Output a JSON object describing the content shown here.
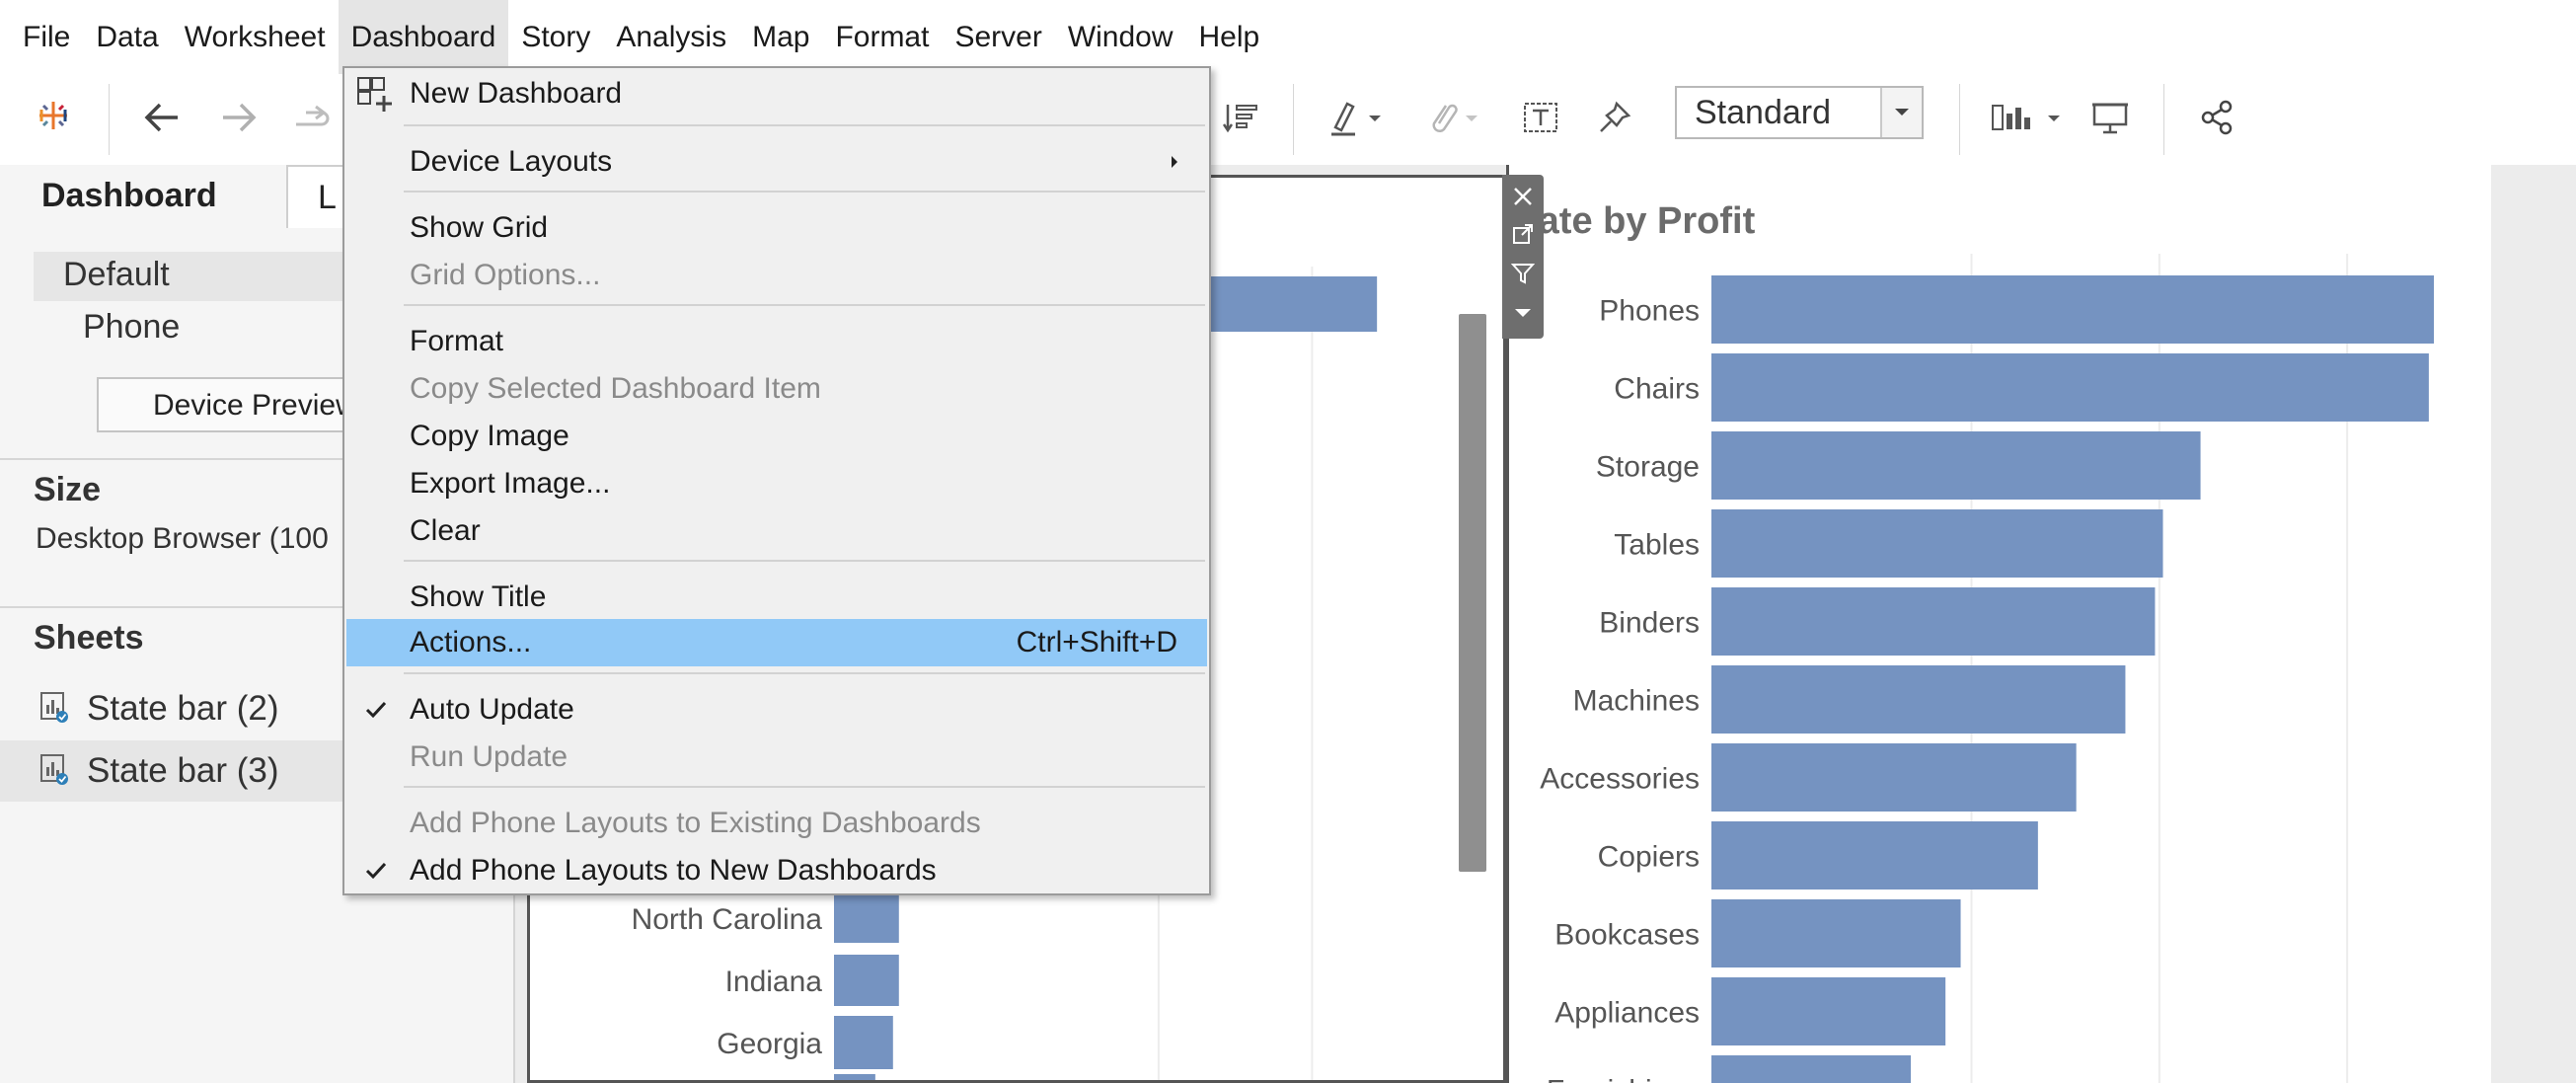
{
  "menubar": {
    "items": [
      "File",
      "Data",
      "Worksheet",
      "Dashboard",
      "Story",
      "Analysis",
      "Map",
      "Format",
      "Server",
      "Window",
      "Help"
    ],
    "active": "Dashboard"
  },
  "toolbar": {
    "fit_select_value": "Standard",
    "icons": [
      "tableau-logo-icon",
      "back-arrow-icon",
      "forward-arrow-icon",
      "redo-icon",
      "sort-icon",
      "highlight-icon",
      "attachment-icon",
      "text-box-icon",
      "pin-icon",
      "show-me-icon",
      "presentation-icon",
      "share-icon"
    ]
  },
  "left_panel": {
    "tabs": {
      "dashboard": "Dashboard",
      "layout": "L"
    },
    "device_default": "Default",
    "device_phone": "Phone",
    "device_preview_button": "Device Preview",
    "size_heading": "Size",
    "size_value": "Desktop Browser (100",
    "sheets_heading": "Sheets",
    "sheets": [
      "State bar (2)",
      "State bar (3)"
    ]
  },
  "dropdown": {
    "items": [
      {
        "label": "New Dashboard",
        "enabled": true,
        "icon": "new-dashboard-icon"
      },
      {
        "label": "Device Layouts",
        "enabled": true,
        "submenu": true
      },
      {
        "label": "Show Grid",
        "enabled": true
      },
      {
        "label": "Grid Options...",
        "enabled": false
      },
      {
        "label": "Format",
        "enabled": true
      },
      {
        "label": "Copy Selected Dashboard Item",
        "enabled": false
      },
      {
        "label": "Copy Image",
        "enabled": true
      },
      {
        "label": "Export Image...",
        "enabled": true
      },
      {
        "label": "Clear",
        "enabled": true
      },
      {
        "label": "Show Title",
        "enabled": true
      },
      {
        "label": "Actions...",
        "enabled": true,
        "shortcut": "Ctrl+Shift+D",
        "highlighted": true
      },
      {
        "label": "Auto Update",
        "enabled": true,
        "checked": true
      },
      {
        "label": "Run Update",
        "enabled": false
      },
      {
        "label": "Add Phone Layouts to Existing Dashboards",
        "enabled": false
      },
      {
        "label": "Add Phone Layouts to New Dashboards",
        "enabled": true,
        "checked": true
      }
    ]
  },
  "left_chart": {
    "type": "bar",
    "visible_categories": [
      "North Carolina",
      "Indiana",
      "Georgia"
    ],
    "bar_color": "#7593c1",
    "bars": [
      {
        "category": "",
        "value": 0.92
      },
      {
        "category": "",
        "value": 0.62
      },
      {
        "category": "North Carolina",
        "value": 0.11
      },
      {
        "category": "Indiana",
        "value": 0.11
      },
      {
        "category": "Georgia",
        "value": 0.1
      },
      {
        "category": "",
        "value": 0.07
      }
    ]
  },
  "chart_data": {
    "type": "bar",
    "title": "tate by Profit",
    "categories": [
      "Phones",
      "Chairs",
      "Storage",
      "Tables",
      "Binders",
      "Machines",
      "Accessories",
      "Copiers",
      "Bookcases",
      "Appliances",
      "Furnishings"
    ],
    "values": [
      1.0,
      0.993,
      0.677,
      0.625,
      0.614,
      0.573,
      0.505,
      0.452,
      0.345,
      0.324,
      0.276
    ],
    "bar_color": "#7593c1",
    "xlim": [
      0,
      1
    ],
    "grid": true
  }
}
